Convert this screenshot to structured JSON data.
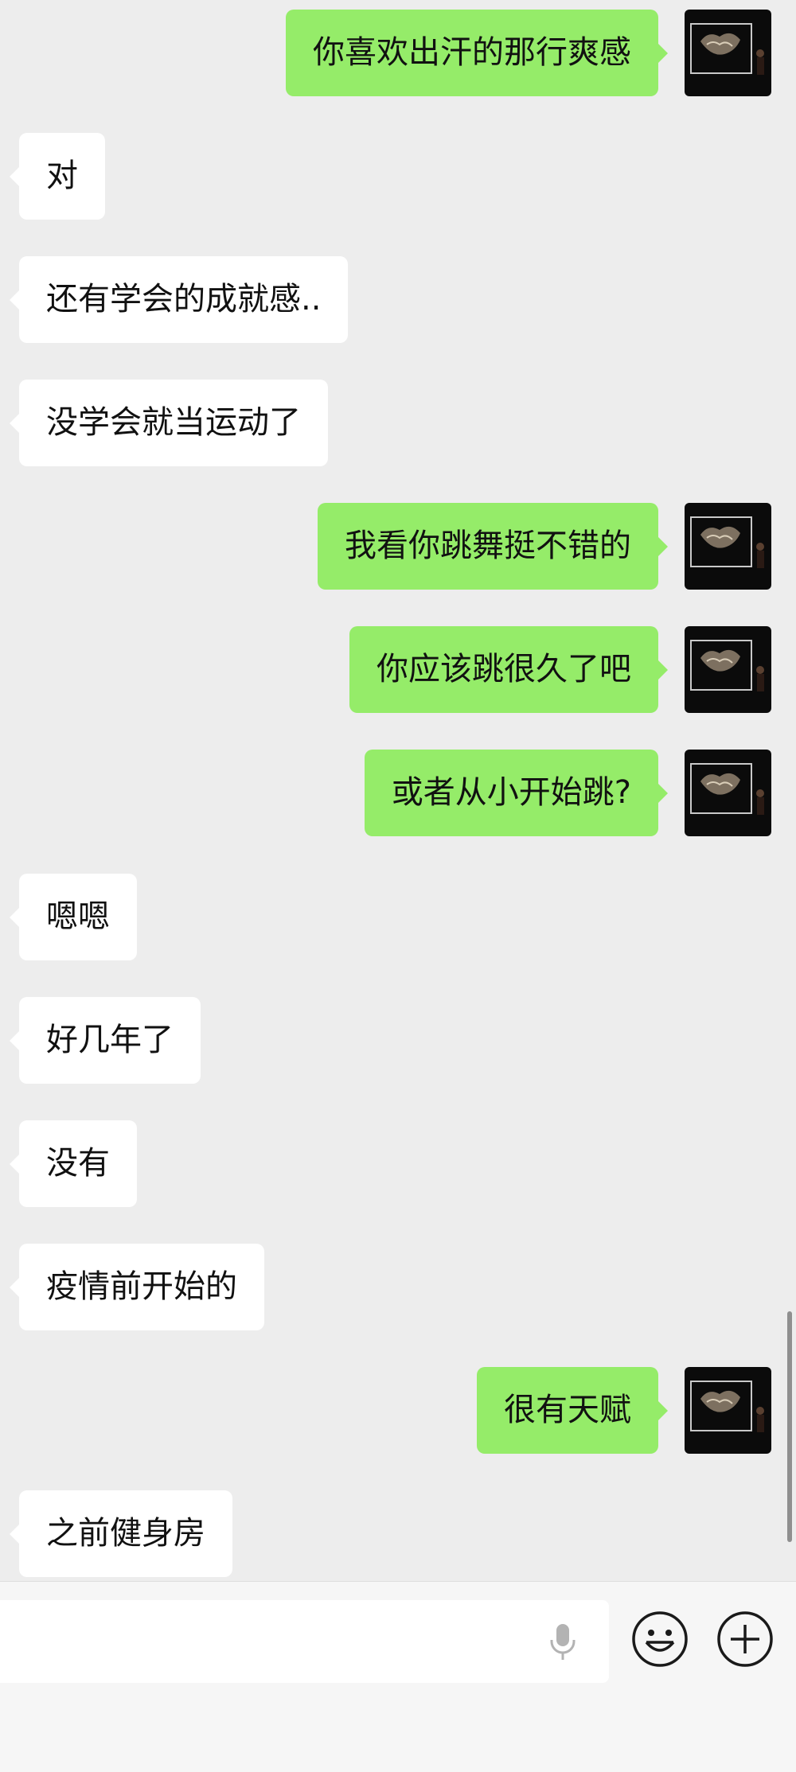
{
  "chat": {
    "messages": [
      {
        "dir": "out",
        "text": "你喜欢出汗的那行爽感"
      },
      {
        "dir": "in",
        "text": "对"
      },
      {
        "dir": "in",
        "text": "还有学会的成就感.."
      },
      {
        "dir": "in",
        "text": "没学会就当运动了"
      },
      {
        "dir": "out",
        "text": "我看你跳舞挺不错的"
      },
      {
        "dir": "out",
        "text": "你应该跳很久了吧"
      },
      {
        "dir": "out",
        "text": "或者从小开始跳?"
      },
      {
        "dir": "in",
        "text": "嗯嗯"
      },
      {
        "dir": "in",
        "text": "好几年了"
      },
      {
        "dir": "in",
        "text": "没有"
      },
      {
        "dir": "in",
        "text": "疫情前开始的"
      },
      {
        "dir": "out",
        "text": "很有天赋"
      },
      {
        "dir": "in",
        "text": "之前健身房"
      }
    ]
  },
  "input_bar": {
    "message_value": "",
    "icons": {
      "voice": "microphone-icon",
      "emoji": "smiley-face-icon",
      "more": "plus-circle-icon"
    }
  },
  "colors": {
    "background": "#ededed",
    "incoming_bubble": "#ffffff",
    "outgoing_bubble": "#95ec69",
    "text": "#111111"
  }
}
